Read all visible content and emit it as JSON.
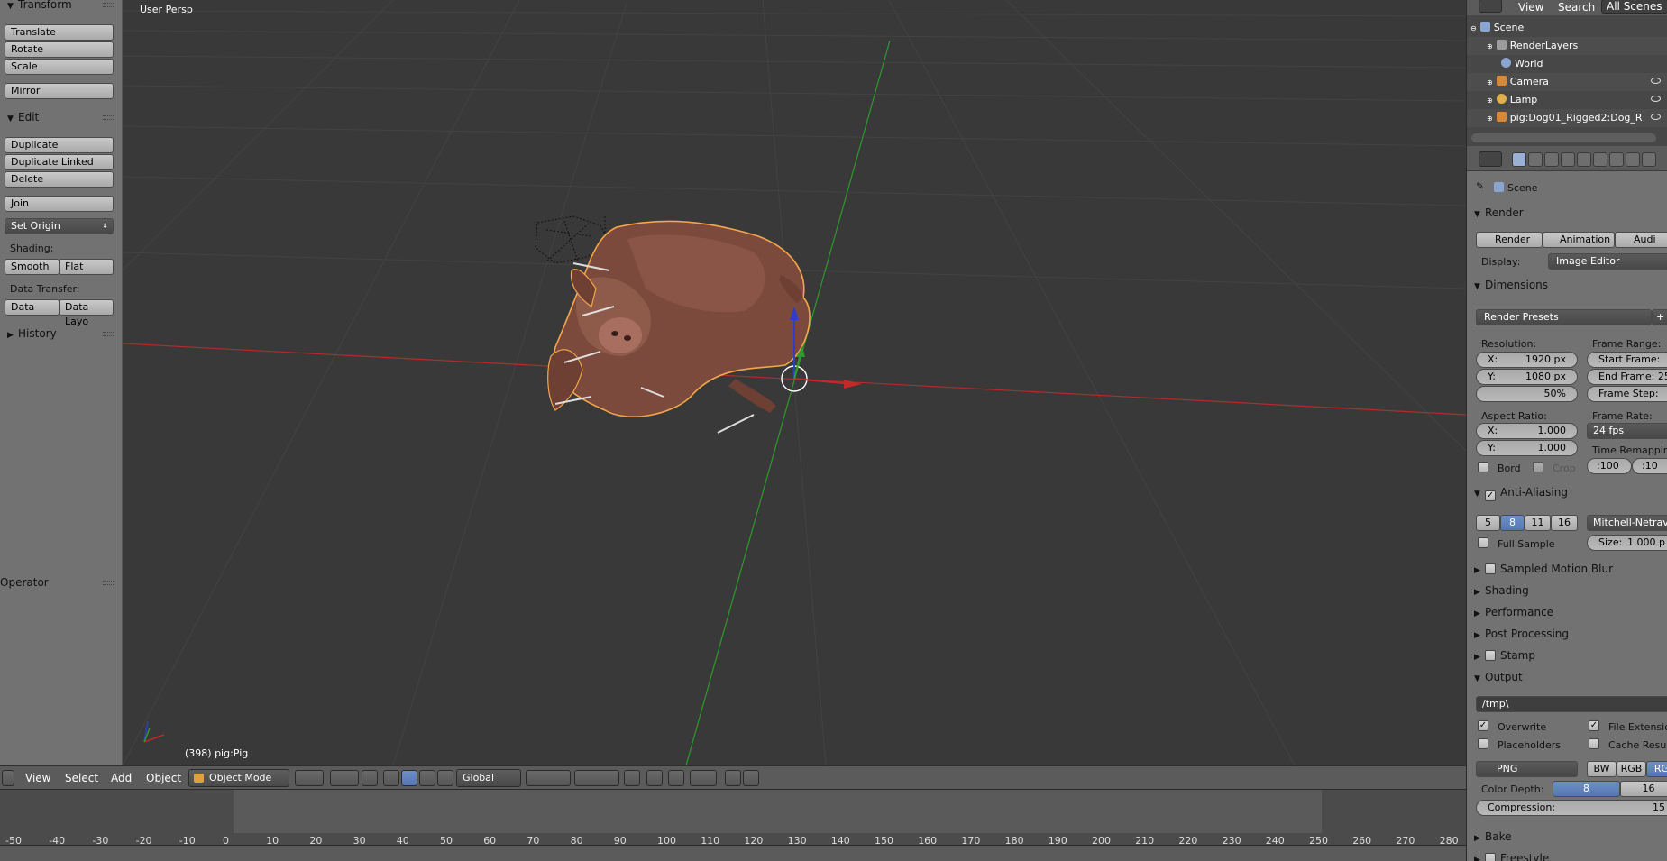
{
  "toolshelf": {
    "transform_header": "Transform",
    "translate": "Translate",
    "rotate": "Rotate",
    "scale": "Scale",
    "mirror": "Mirror",
    "edit_header": "Edit",
    "duplicate": "Duplicate",
    "duplicate_linked": "Duplicate Linked",
    "delete": "Delete",
    "join": "Join",
    "set_origin": "Set Origin",
    "shading_label": "Shading:",
    "smooth": "Smooth",
    "flat": "Flat",
    "data_transfer_label": "Data Transfer:",
    "data": "Data",
    "data_layout": "Data Layo",
    "history_header": "History",
    "operator_header": "Operator"
  },
  "viewport": {
    "view_label": "User Persp",
    "object_info": "(398) pig:Pig"
  },
  "view_header": {
    "view": "View",
    "select": "Select",
    "add": "Add",
    "object": "Object",
    "mode": "Object Mode",
    "orientation": "Global"
  },
  "timeline": {
    "ticks": [
      "-50",
      "-40",
      "-30",
      "-20",
      "-10",
      "0",
      "10",
      "20",
      "30",
      "40",
      "50",
      "60",
      "70",
      "80",
      "90",
      "100",
      "110",
      "120",
      "130",
      "140",
      "150",
      "160",
      "170",
      "180",
      "190",
      "200",
      "210",
      "220",
      "230",
      "240",
      "250",
      "260",
      "270",
      "280"
    ]
  },
  "outliner": {
    "view": "View",
    "search": "Search",
    "all_scenes": "All Scenes",
    "items": [
      {
        "label": "Scene"
      },
      {
        "label": "RenderLayers"
      },
      {
        "label": "World"
      },
      {
        "label": "Camera"
      },
      {
        "label": "Lamp"
      },
      {
        "label": "pig:Dog01_Rigged2:Dog_R"
      }
    ]
  },
  "properties": {
    "context": "Scene",
    "render_header": "Render",
    "render_btn": "Render",
    "animation_btn": "Animation",
    "audio_btn": "Audi",
    "display_label": "Display:",
    "display_value": "Image Editor",
    "dimensions_header": "Dimensions",
    "render_presets": "Render Presets",
    "resolution_label": "Resolution:",
    "res_x_label": "X:",
    "res_x": "1920 px",
    "res_y_label": "Y:",
    "res_y": "1080 px",
    "res_pct": "50%",
    "frame_range_label": "Frame Range:",
    "start_frame": "Start Frame:",
    "end_frame": "End Frame: 25",
    "frame_step": "Frame Step:",
    "aspect_label": "Aspect Ratio:",
    "asp_x_label": "X:",
    "asp_x": "1.000",
    "asp_y_label": "Y:",
    "asp_y": "1.000",
    "frame_rate_label": "Frame Rate:",
    "fps": "24 fps",
    "time_remap_label": "Time Remapping",
    "remap_old": ":100",
    "remap_new": ":10",
    "bord": "Bord",
    "crop": "Crop",
    "aa_header": "Anti-Aliasing",
    "aa_5": "5",
    "aa_8": "8",
    "aa_11": "11",
    "aa_16": "16",
    "aa_filter": "Mitchell-Netrava",
    "full_sample": "Full Sample",
    "size_label": "Size:",
    "size_value": "1.000 p",
    "motion_blur": "Sampled Motion Blur",
    "shading": "Shading",
    "performance": "Performance",
    "post_processing": "Post Processing",
    "stamp": "Stamp",
    "output_header": "Output",
    "output_path": "/tmp\\",
    "overwrite": "Overwrite",
    "file_extensions": "File Extension",
    "placeholders": "Placeholders",
    "cache_result": "Cache Result",
    "format": "PNG",
    "bw": "BW",
    "rgb": "RGB",
    "rgba": "RG",
    "color_depth_label": "Color Depth:",
    "depth_8": "8",
    "depth_16": "16",
    "compression_label": "Compression:",
    "compression_value": "15",
    "bake": "Bake",
    "freestyle": "Freestyle"
  },
  "colors": {
    "accent": "#5680c2",
    "x_axis": "#c22a2a",
    "y_axis": "#2c9a2c",
    "z_axis": "#2d3ec8",
    "selection_outline": "#f5a64a"
  }
}
